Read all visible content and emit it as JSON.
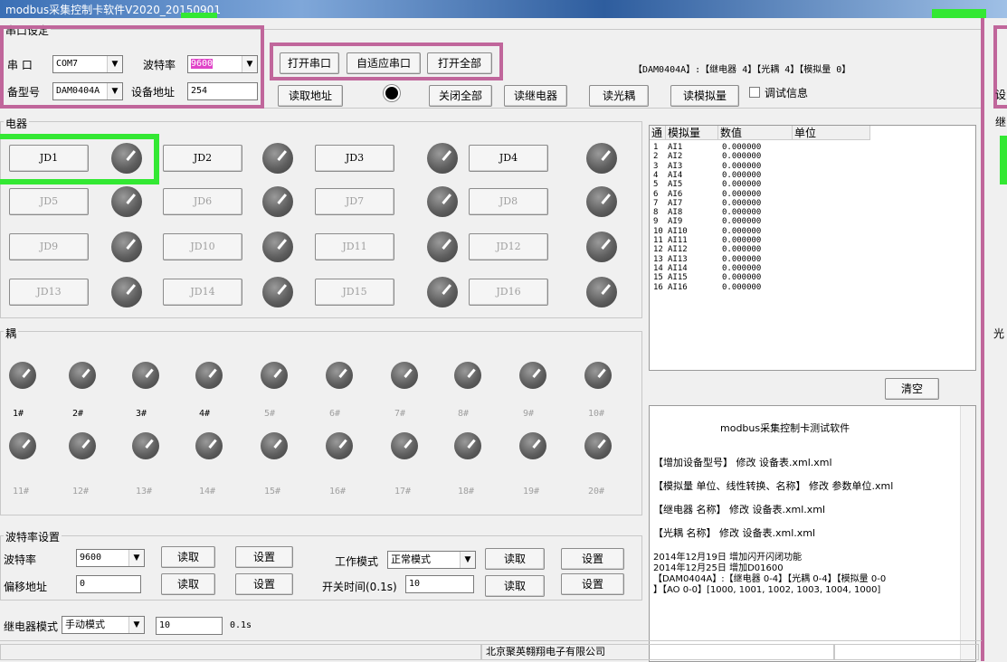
{
  "title": "modbus采集控制卡软件V2020_20150901",
  "serial": {
    "group": "串口设定",
    "port_label": "串 口",
    "port_value": "COM7",
    "baud_label": "波特率",
    "baud_value": "9600",
    "model_label": "备型号",
    "model_value": "DAM0404A",
    "addr_label": "设备地址",
    "addr_value": "254"
  },
  "toolbar": {
    "open_port": "打开串口",
    "auto_port": "自适应串口",
    "open_all": "打开全部",
    "read_addr": "读取地址",
    "close_all": "关闭全部",
    "read_relay": "读继电器",
    "read_opto": "读光耦",
    "read_analog": "读模拟量",
    "debug_info": "调试信息",
    "device_info": "【DAM0404A】:【继电器 4】【光耦 4】【模拟量 0】"
  },
  "relay": {
    "group": "电器",
    "buttons": [
      "JD1",
      "JD2",
      "JD3",
      "JD4",
      "JD5",
      "JD6",
      "JD7",
      "JD8",
      "JD9",
      "JD10",
      "JD11",
      "JD12",
      "JD13",
      "JD14",
      "JD15",
      "JD16"
    ]
  },
  "opto": {
    "group": "耦",
    "labels": [
      "1#",
      "2#",
      "3#",
      "4#",
      "5#",
      "6#",
      "7#",
      "8#",
      "9#",
      "10#",
      "11#",
      "12#",
      "13#",
      "14#",
      "15#",
      "16#",
      "17#",
      "18#",
      "19#",
      "20#"
    ]
  },
  "analog_table": {
    "headers": [
      "通",
      "模拟量",
      "数值",
      "单位"
    ],
    "rows": [
      [
        "1",
        "AI1",
        "0.000000"
      ],
      [
        "2",
        "AI2",
        "0.000000"
      ],
      [
        "3",
        "AI3",
        "0.000000"
      ],
      [
        "4",
        "AI4",
        "0.000000"
      ],
      [
        "5",
        "AI5",
        "0.000000"
      ],
      [
        "6",
        "AI6",
        "0.000000"
      ],
      [
        "7",
        "AI7",
        "0.000000"
      ],
      [
        "8",
        "AI8",
        "0.000000"
      ],
      [
        "9",
        "AI9",
        "0.000000"
      ],
      [
        "10",
        "AI10",
        "0.000000"
      ],
      [
        "11",
        "AI11",
        "0.000000"
      ],
      [
        "12",
        "AI12",
        "0.000000"
      ],
      [
        "13",
        "AI13",
        "0.000000"
      ],
      [
        "14",
        "AI14",
        "0.000000"
      ],
      [
        "15",
        "AI15",
        "0.000000"
      ],
      [
        "16",
        "AI16",
        "0.000000"
      ]
    ],
    "clear": "清空"
  },
  "log": {
    "title": "modbus采集控制卡测试软件",
    "l1": "【增加设备型号】 修改  设备表.xml.xml",
    "l2": "【模拟量 单位、线性转换、名称】 修改 参数单位.xml",
    "l3": "【继电器 名称】 修改  设备表.xml.xml",
    "l4": "【光耦 名称】 修改  设备表.xml.xml",
    "l5": "2014年12月19日  增加闪开闪闭功能",
    "l6": "2014年12月25日  增加D01600",
    "l7": "【DAM0404A】:【继电器  0-4】【光耦 0-4】【模拟量 0-0",
    "l8": "】【AO 0-0】[1000, 1001, 1002, 1003, 1004, 1000]"
  },
  "settings": {
    "group": "波特率设置",
    "baud_label": "波特率",
    "baud_value": "9600",
    "read": "读取",
    "set": "设置",
    "offset_label": "偏移地址",
    "offset_value": "0",
    "mode_label": "工作模式",
    "mode_value": "正常模式",
    "time_label": "开关时间(0.1s)",
    "time_value": "10",
    "relay_mode_label": "继电器模式",
    "relay_mode_value": "手动模式",
    "relay_mode_time": "10",
    "relay_mode_unit": "0.1s"
  },
  "right_panel": {
    "l1": "设",
    "l2": "继",
    "l3": "光"
  },
  "status": {
    "company": "北京聚英翱翔电子有限公司"
  }
}
